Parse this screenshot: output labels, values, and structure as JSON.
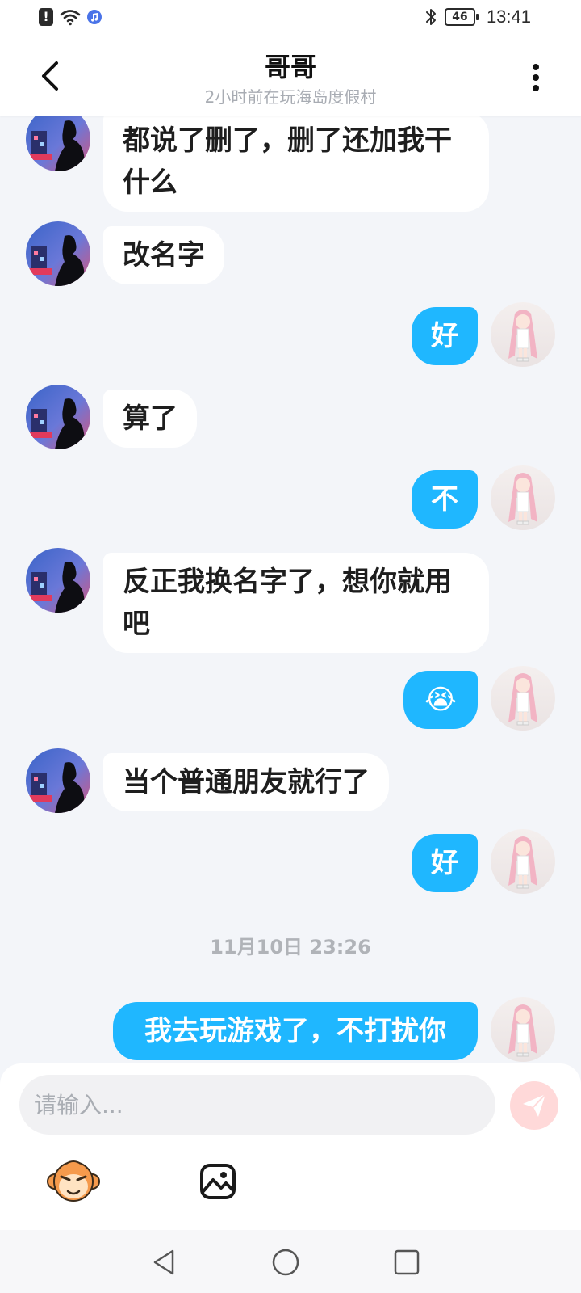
{
  "status_bar": {
    "time": "13:41",
    "battery": "46",
    "icons": [
      "alert-icon",
      "wifi-icon",
      "music-icon",
      "bluetooth-icon",
      "battery-icon"
    ]
  },
  "header": {
    "title": "哥哥",
    "subtitle": "2小时前在玩海岛度假村",
    "back_icon": "chevron-left-icon",
    "more_icon": "more-vertical-icon"
  },
  "messages": [
    {
      "side": "other",
      "text_lines": [
        "都说了删了，删了还加我干",
        "什么"
      ]
    },
    {
      "side": "other",
      "text_lines": [
        "改名字"
      ]
    },
    {
      "side": "me",
      "text_lines": [
        "好"
      ]
    },
    {
      "side": "other",
      "text_lines": [
        "算了"
      ]
    },
    {
      "side": "me",
      "text_lines": [
        "不"
      ]
    },
    {
      "side": "other",
      "text_lines": [
        "反正我换名字了，想你就用",
        "吧"
      ]
    },
    {
      "side": "me",
      "text_lines": [
        "😭"
      ]
    },
    {
      "side": "other",
      "text_lines": [
        "当个普通朋友就行了"
      ]
    },
    {
      "side": "me",
      "text_lines": [
        "好"
      ]
    },
    {
      "side": "timestamp",
      "text_lines": [
        "11月10日 23:26"
      ]
    },
    {
      "side": "me",
      "text_lines": [
        "我去玩游戏了，不打扰你"
      ]
    }
  ],
  "composer": {
    "placeholder": "请输入...",
    "send_icon": "send-icon",
    "emoji_icon": "monkey-emoji-icon",
    "image_icon": "image-icon"
  },
  "nav": {
    "icons": [
      "back-triangle-icon",
      "home-circle-icon",
      "recents-square-icon"
    ]
  },
  "colors": {
    "my_bubble": "#1fb7ff",
    "other_bubble": "#ffffff",
    "background": "#f3f5f9",
    "send_button": "#ffd9d9"
  }
}
